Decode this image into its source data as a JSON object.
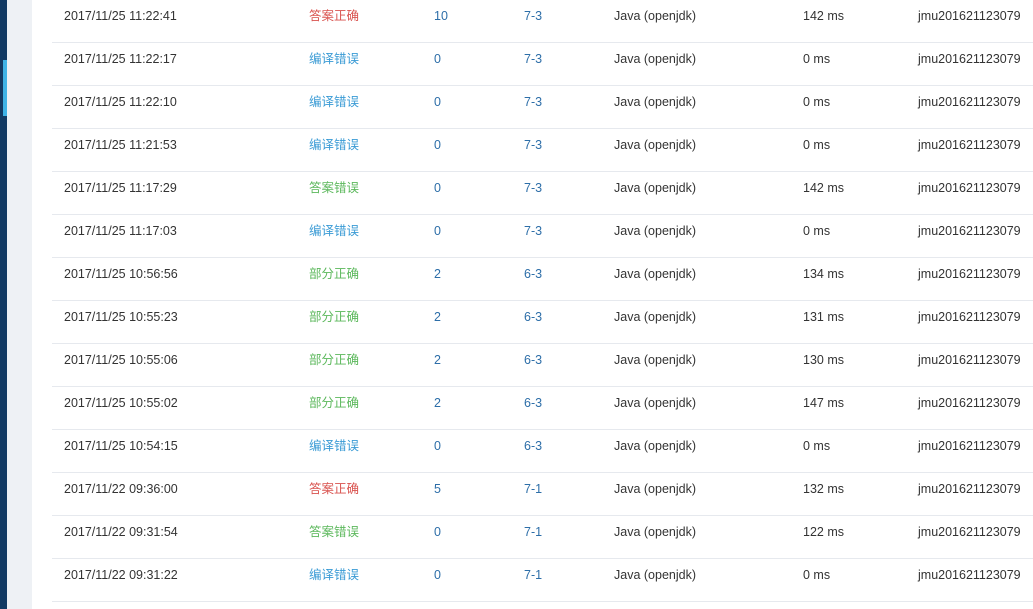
{
  "submissions": [
    {
      "time": "2017/11/25 11:22:41",
      "status": "答案正确",
      "status_kind": "correct",
      "score": "10",
      "problem": "7-3",
      "compiler": "Java (openjdk)",
      "runtime": "142 ms",
      "user": "jmu201621123079"
    },
    {
      "time": "2017/11/25 11:22:17",
      "status": "编译错误",
      "status_kind": "compile",
      "score": "0",
      "problem": "7-3",
      "compiler": "Java (openjdk)",
      "runtime": "0 ms",
      "user": "jmu201621123079"
    },
    {
      "time": "2017/11/25 11:22:10",
      "status": "编译错误",
      "status_kind": "compile",
      "score": "0",
      "problem": "7-3",
      "compiler": "Java (openjdk)",
      "runtime": "0 ms",
      "user": "jmu201621123079"
    },
    {
      "time": "2017/11/25 11:21:53",
      "status": "编译错误",
      "status_kind": "compile",
      "score": "0",
      "problem": "7-3",
      "compiler": "Java (openjdk)",
      "runtime": "0 ms",
      "user": "jmu201621123079"
    },
    {
      "time": "2017/11/25 11:17:29",
      "status": "答案错误",
      "status_kind": "wrong",
      "score": "0",
      "problem": "7-3",
      "compiler": "Java (openjdk)",
      "runtime": "142 ms",
      "user": "jmu201621123079"
    },
    {
      "time": "2017/11/25 11:17:03",
      "status": "编译错误",
      "status_kind": "compile",
      "score": "0",
      "problem": "7-3",
      "compiler": "Java (openjdk)",
      "runtime": "0 ms",
      "user": "jmu201621123079"
    },
    {
      "time": "2017/11/25 10:56:56",
      "status": "部分正确",
      "status_kind": "partial",
      "score": "2",
      "problem": "6-3",
      "compiler": "Java (openjdk)",
      "runtime": "134 ms",
      "user": "jmu201621123079"
    },
    {
      "time": "2017/11/25 10:55:23",
      "status": "部分正确",
      "status_kind": "partial",
      "score": "2",
      "problem": "6-3",
      "compiler": "Java (openjdk)",
      "runtime": "131 ms",
      "user": "jmu201621123079"
    },
    {
      "time": "2017/11/25 10:55:06",
      "status": "部分正确",
      "status_kind": "partial",
      "score": "2",
      "problem": "6-3",
      "compiler": "Java (openjdk)",
      "runtime": "130 ms",
      "user": "jmu201621123079"
    },
    {
      "time": "2017/11/25 10:55:02",
      "status": "部分正确",
      "status_kind": "partial",
      "score": "2",
      "problem": "6-3",
      "compiler": "Java (openjdk)",
      "runtime": "147 ms",
      "user": "jmu201621123079"
    },
    {
      "time": "2017/11/25 10:54:15",
      "status": "编译错误",
      "status_kind": "compile",
      "score": "0",
      "problem": "6-3",
      "compiler": "Java (openjdk)",
      "runtime": "0 ms",
      "user": "jmu201621123079"
    },
    {
      "time": "2017/11/22 09:36:00",
      "status": "答案正确",
      "status_kind": "correct",
      "score": "5",
      "problem": "7-1",
      "compiler": "Java (openjdk)",
      "runtime": "132 ms",
      "user": "jmu201621123079"
    },
    {
      "time": "2017/11/22 09:31:54",
      "status": "答案错误",
      "status_kind": "wrong",
      "score": "0",
      "problem": "7-1",
      "compiler": "Java (openjdk)",
      "runtime": "122 ms",
      "user": "jmu201621123079"
    },
    {
      "time": "2017/11/22 09:31:22",
      "status": "编译错误",
      "status_kind": "compile",
      "score": "0",
      "problem": "7-1",
      "compiler": "Java (openjdk)",
      "runtime": "0 ms",
      "user": "jmu201621123079"
    }
  ],
  "colors": {
    "correct": "#d9534f",
    "compile_error": "#3a9bd5",
    "wrong_or_partial": "#5cb85c",
    "link": "#2d6ea8",
    "sidebar": "#123a63",
    "sidebar_active": "#3fb3e6"
  }
}
